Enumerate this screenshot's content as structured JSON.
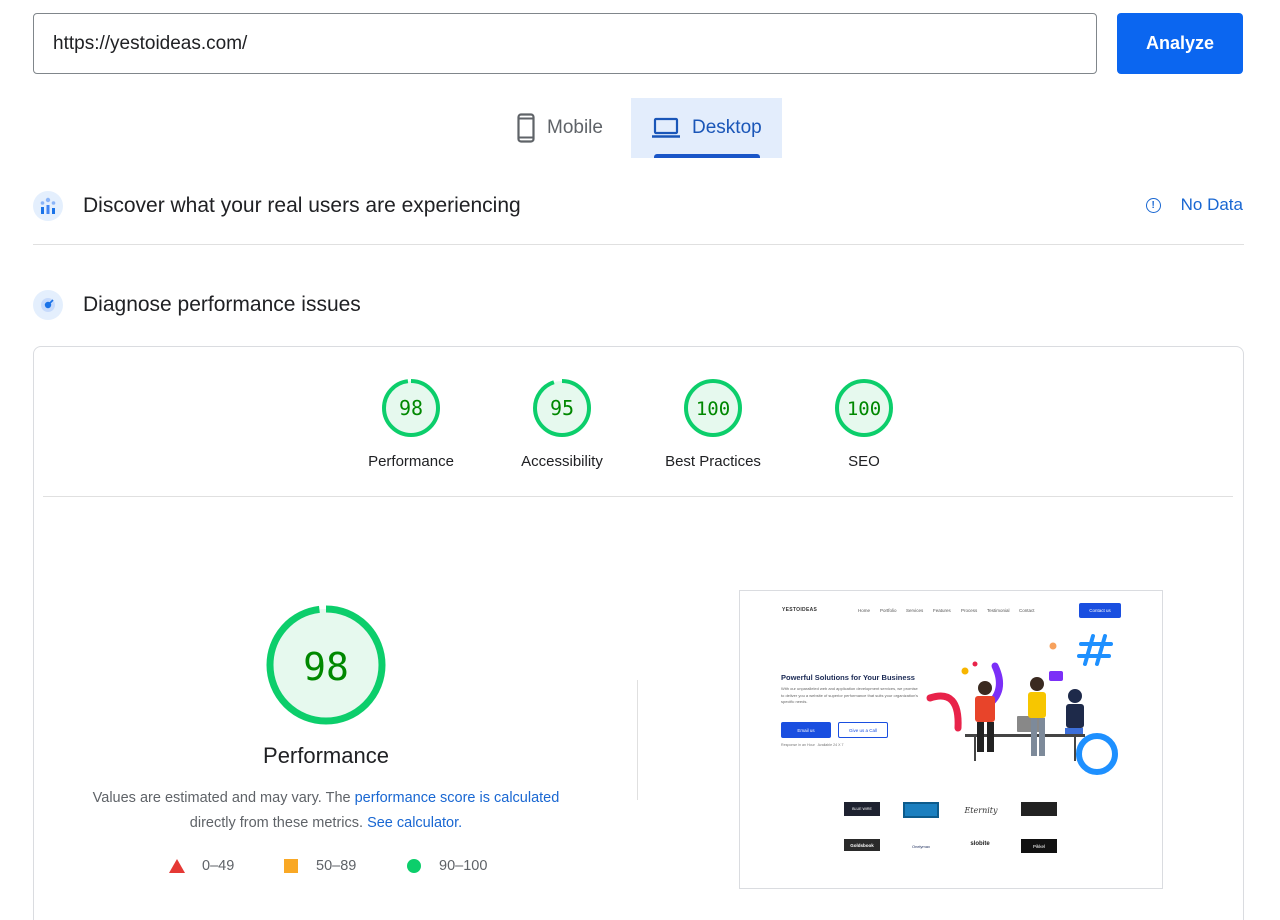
{
  "search": {
    "url_value": "https://yestoideas.com/",
    "analyze_label": "Analyze"
  },
  "tabs": [
    {
      "label": "Mobile",
      "icon": "phone-icon",
      "selected": false
    },
    {
      "label": "Desktop",
      "icon": "laptop-icon",
      "selected": true
    }
  ],
  "field_data": {
    "title": "Discover what your real users are experiencing",
    "status": "No Data",
    "icon": "users-chart-icon"
  },
  "lab_data": {
    "title": "Diagnose performance issues",
    "icon": "lighthouse-icon"
  },
  "scores": [
    {
      "label": "Performance",
      "value": 98
    },
    {
      "label": "Accessibility",
      "value": 95
    },
    {
      "label": "Best Practices",
      "value": 100
    },
    {
      "label": "SEO",
      "value": 100
    }
  ],
  "main_score": {
    "value": 98,
    "label": "Performance"
  },
  "description": {
    "part1": "Values are estimated and may vary. The ",
    "link1": "performance score is calculated",
    "part2": "directly from these metrics. ",
    "link2": "See calculator."
  },
  "legend": [
    {
      "range": "0–49",
      "shape": "triangle",
      "color": "#e53935"
    },
    {
      "range": "50–89",
      "shape": "square",
      "color": "#f9a825"
    },
    {
      "range": "90–100",
      "shape": "circle",
      "color": "#0cce6b"
    }
  ],
  "colors": {
    "pass": "#0cce6b",
    "pass_text": "#008800",
    "pass_bg": "#e6f9ee",
    "accent": "#1a73e8"
  },
  "preview": {
    "logo": "YESTOIDEAS",
    "nav": [
      "Home",
      "Portfolio",
      "Services",
      "Features",
      "Process",
      "Testimonial",
      "Contact"
    ],
    "contact_btn": "Contact us",
    "hero_title": "Powerful Solutions for Your Business",
    "hero_sub": "With our unparalleled web and application development services, we promise to deliver you a website of superior performance that suits your organization's specific needs.",
    "btn_primary": "Email us",
    "btn_secondary": "Give us a Call",
    "tags": [
      "Response in an Hour",
      "Available 24 X 7"
    ],
    "clients": [
      "BLUE WIRE",
      "",
      "Eternity",
      "",
      "Goldsbook",
      "Onelymax",
      "slobite",
      "Pikkel"
    ]
  }
}
